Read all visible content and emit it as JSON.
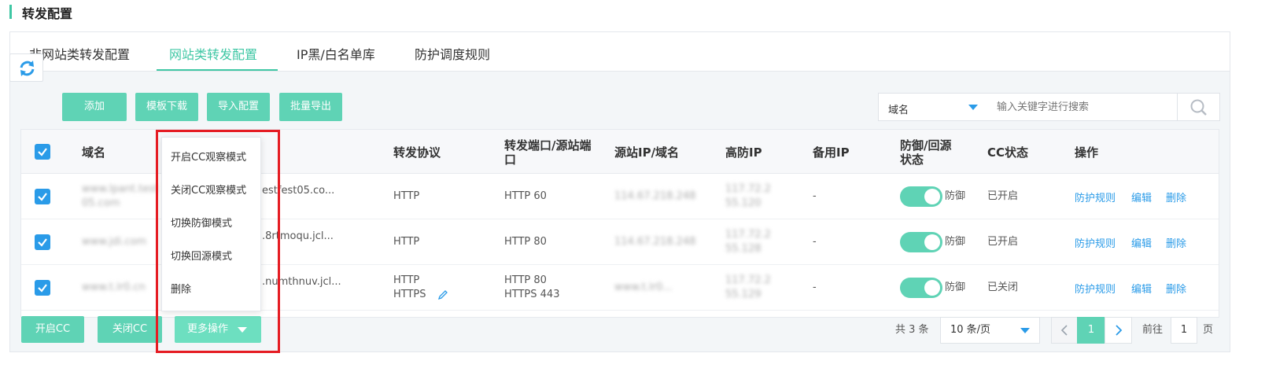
{
  "page": {
    "title": "转发配置"
  },
  "tabs": [
    {
      "label": "非网站类转发配置",
      "active": false
    },
    {
      "label": "网站类转发配置",
      "active": true
    },
    {
      "label": "IP黑/白名单库",
      "active": false
    },
    {
      "label": "防护调度规则",
      "active": false
    }
  ],
  "toolbar": {
    "add": "添加",
    "template_download": "模板下载",
    "import_config": "导入配置",
    "batch_export": "批量导出"
  },
  "search": {
    "field": "域名",
    "placeholder": "输入关键字进行搜索"
  },
  "table": {
    "headers": {
      "domain": "域名",
      "protocol": "转发协议",
      "ports": "转发端口/源站端口",
      "origin": "源站IP/域名",
      "high_ip": "高防IP",
      "backup_ip": "备用IP",
      "defense_state": "防御/回源状态",
      "cc_state": "CC状态",
      "actions": "操作"
    },
    "rows": [
      {
        "domain": "www.lpant.test05.com",
        "cname": "estfest05.co...",
        "protocol": [
          "HTTP"
        ],
        "ports": [
          "HTTP 60"
        ],
        "origin": "114.67.218.248",
        "high_ip": "117.72.255.120",
        "backup_ip": "-",
        "defense": "防御",
        "cc": "已开启",
        "actions": [
          "防护规则",
          "编辑",
          "删除"
        ]
      },
      {
        "domain": "www.jdi.com",
        "cname": ".8rtmoqu.jcl...",
        "protocol": [
          "HTTP"
        ],
        "ports": [
          "HTTP 80"
        ],
        "origin": "114.67.218.248",
        "high_ip": "117.72.255.128",
        "backup_ip": "-",
        "defense": "防御",
        "cc": "已开启",
        "actions": [
          "防护规则",
          "编辑",
          "删除"
        ]
      },
      {
        "domain": "www.t.lr0.cn",
        "cname": ".numthnuv.jcl...",
        "protocol": [
          "HTTP",
          "HTTPS"
        ],
        "ports": [
          "HTTP 80",
          "HTTPS 443"
        ],
        "origin": "www.t.lr0...",
        "high_ip": "117.72.255.129",
        "backup_ip": "-",
        "defense": "防御",
        "cc": "已关闭",
        "actions": [
          "防护规则",
          "编辑",
          "删除"
        ]
      }
    ]
  },
  "bulk": {
    "enable_cc": "开启CC",
    "disable_cc": "关闭CC",
    "more_actions": "更多操作"
  },
  "dropdown_menu": [
    "开启CC观察模式",
    "关闭CC观察模式",
    "切换防御模式",
    "切换回源模式",
    "删除"
  ],
  "pagination": {
    "total": "共 3 条",
    "page_size": "10 条/页",
    "current_page": "1",
    "goto_label": "前往",
    "goto_value": "1",
    "page_unit": "页"
  },
  "colors": {
    "accent": "#3fc7a4",
    "button": "#5fd3b5",
    "link": "#2a9be8",
    "highlight": "#e51c23"
  }
}
